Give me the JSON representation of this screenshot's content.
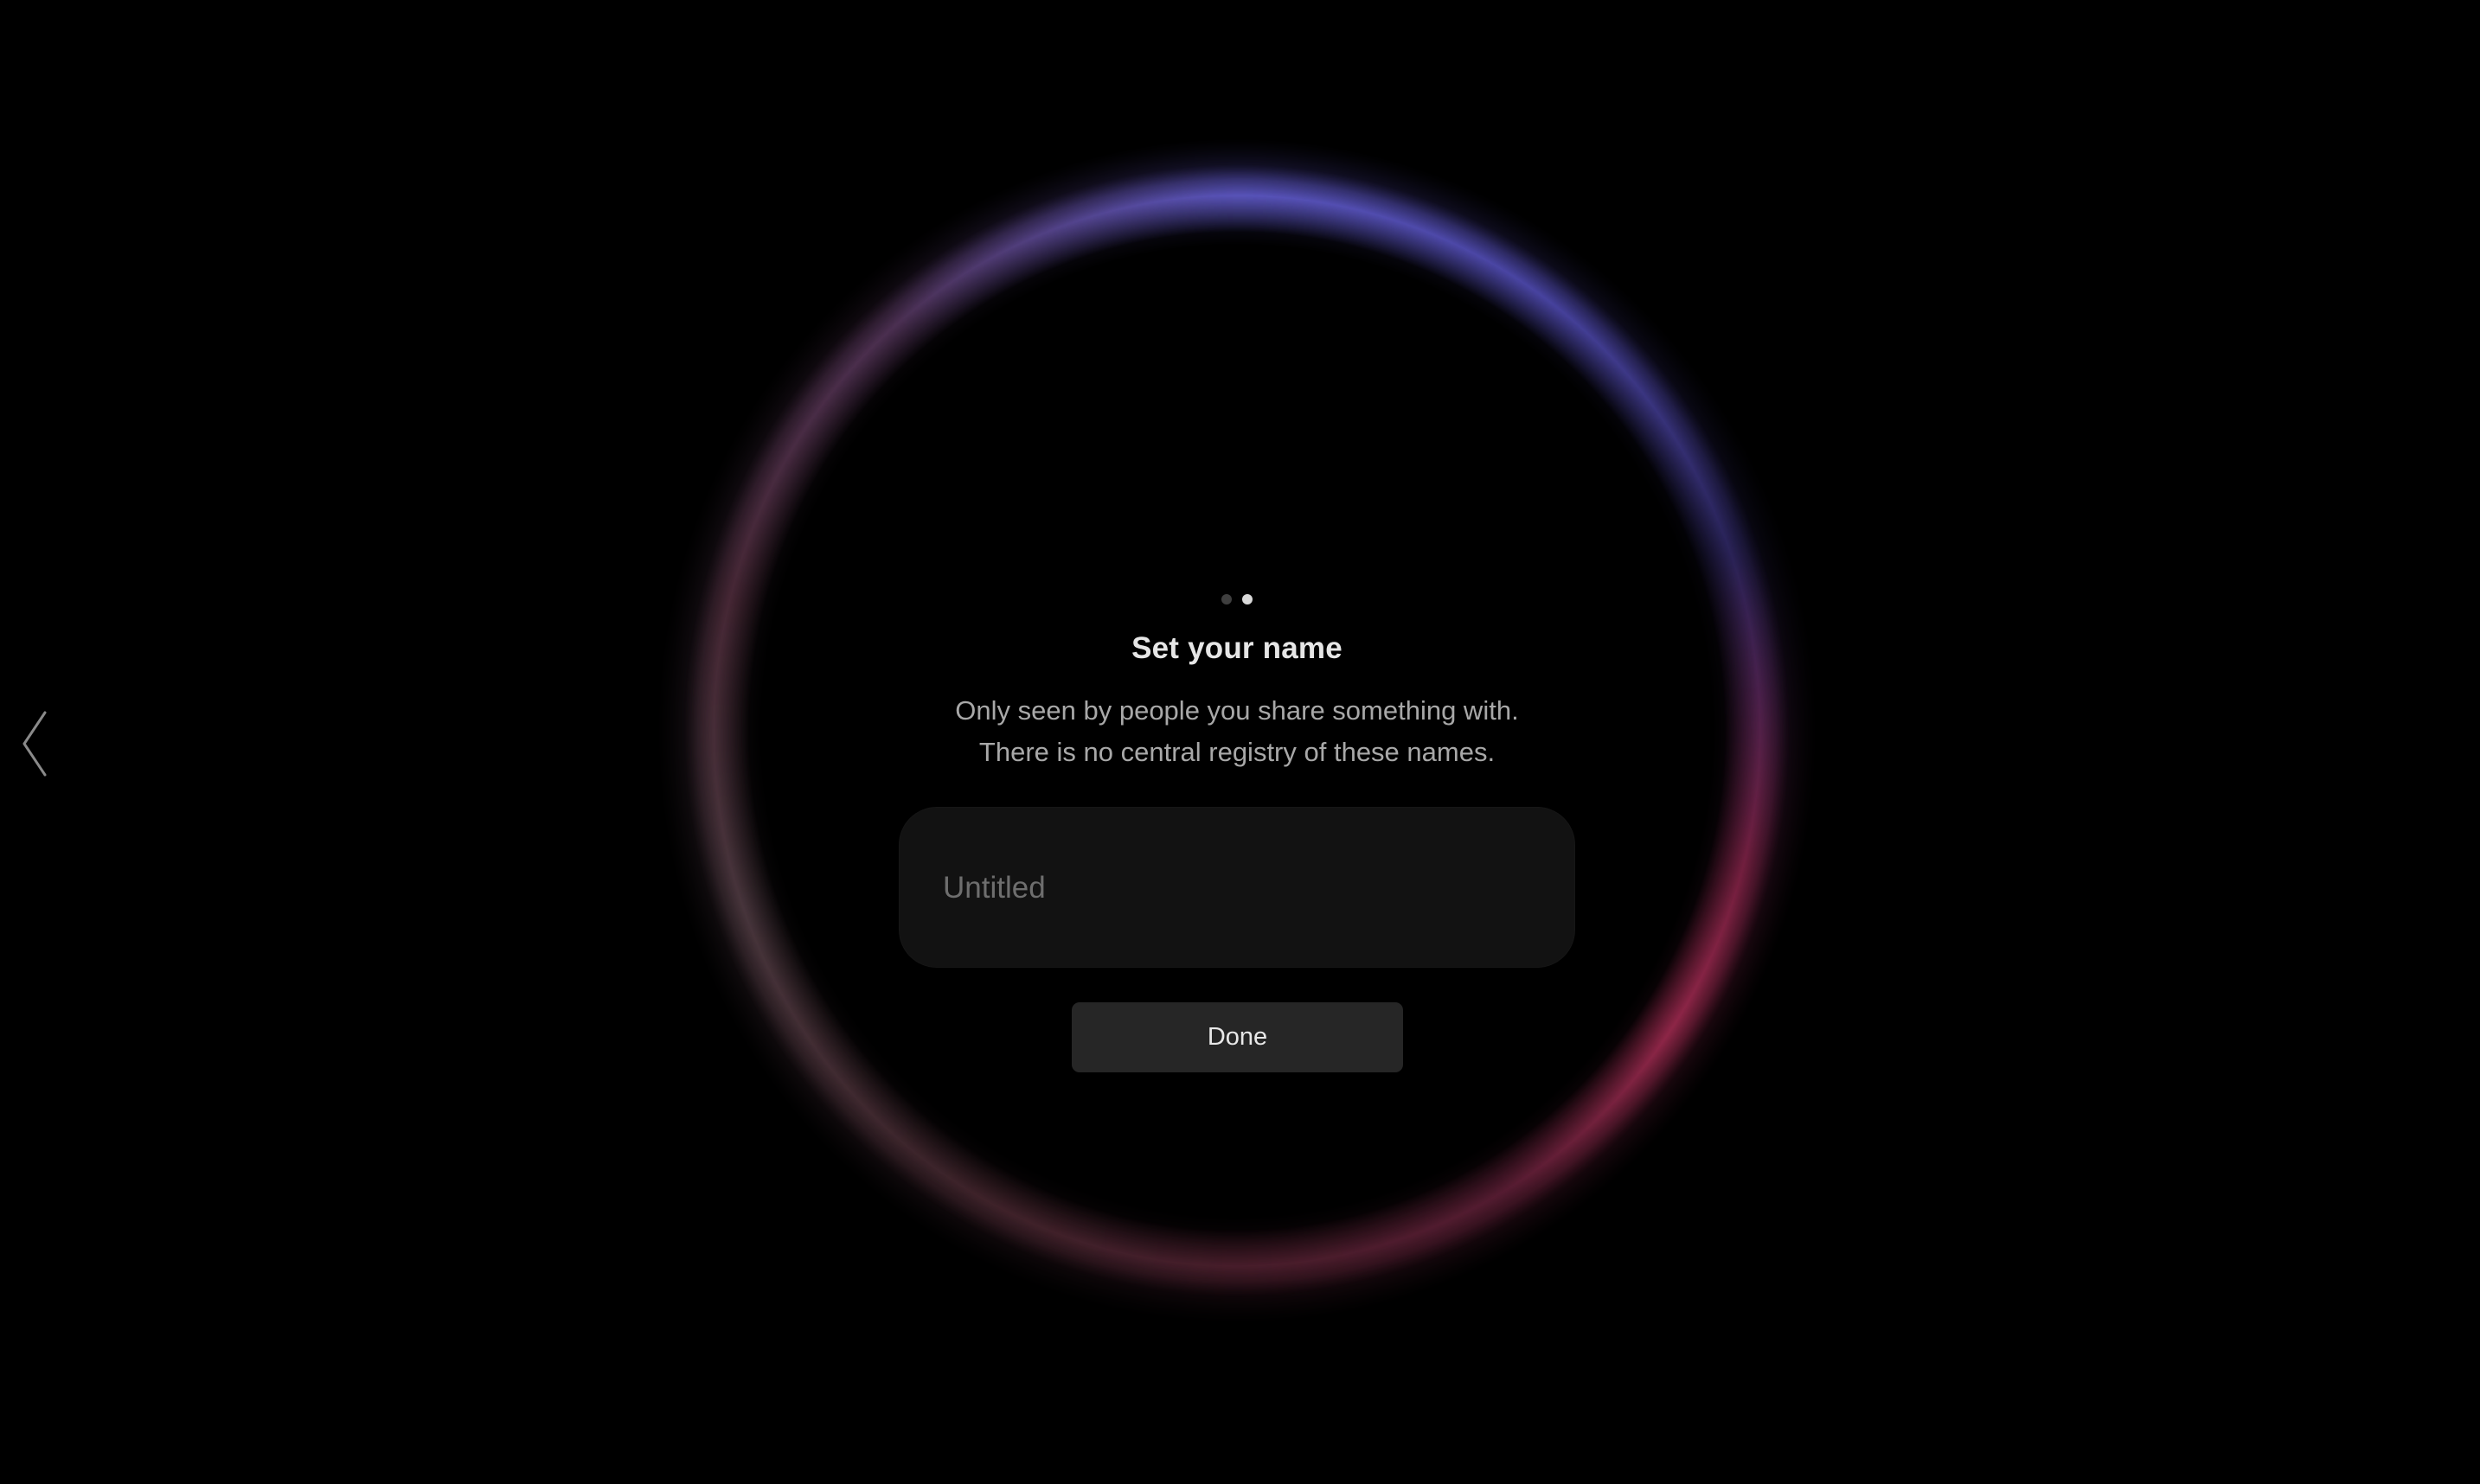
{
  "onboarding": {
    "step_count": 2,
    "current_step": 2,
    "title": "Set your name",
    "subtitle_lines": [
      "Only seen by people you share something with.",
      "There is no central registry of these names."
    ],
    "name_input": {
      "value": "",
      "placeholder": "Untitled"
    },
    "done_label": "Done"
  },
  "icons": {
    "back": "chevron-left-icon"
  },
  "colors": {
    "background": "#000000",
    "ring_blue": "#5f5ac8",
    "ring_red": "#aa2d55",
    "field_background": "#121212",
    "button_background": "#262626",
    "dot_active": "#d9d9d9",
    "dot_inactive": "#3f3f3f"
  }
}
